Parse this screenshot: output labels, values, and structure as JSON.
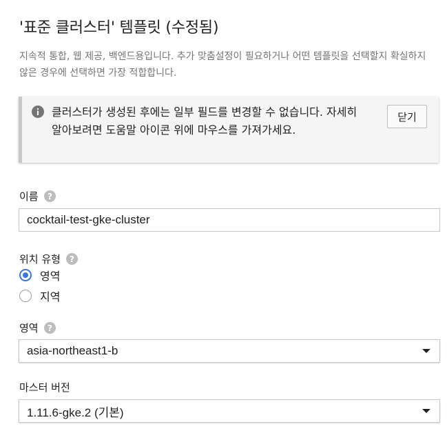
{
  "page": {
    "title": "'표준 클러스터' 템플릿 (수정됨)",
    "description": "지속적 통합, 웹 제공, 백엔드용입니다. 추가 맞춤설정이 필요하거나 어떤 템플릿을 선택할지 확실하지 않은 경우에 선택하면 가장 적합합니다."
  },
  "notice": {
    "icon": "info-icon",
    "message": "클러스터가 생성된 후에는 일부 필드를 변경할 수 없습니다. 자세히 알아보려면 도움말 아이콘 위에 마우스를 가져가세요.",
    "close_label": "닫기"
  },
  "name_field": {
    "label": "이름",
    "value": "cocktail-test-gke-cluster"
  },
  "location_type": {
    "label": "위치 유형",
    "options": [
      {
        "label": "영역",
        "selected": true
      },
      {
        "label": "지역",
        "selected": false
      }
    ]
  },
  "zone": {
    "label": "영역",
    "value": "asia-northeast1-b"
  },
  "master_version": {
    "label": "마스터 버전",
    "value": "1.11.6-gke.2 (기본)"
  },
  "colors": {
    "accent": "#3b77db",
    "help_icon": "#bdbdbd",
    "info_icon": "#757575"
  }
}
